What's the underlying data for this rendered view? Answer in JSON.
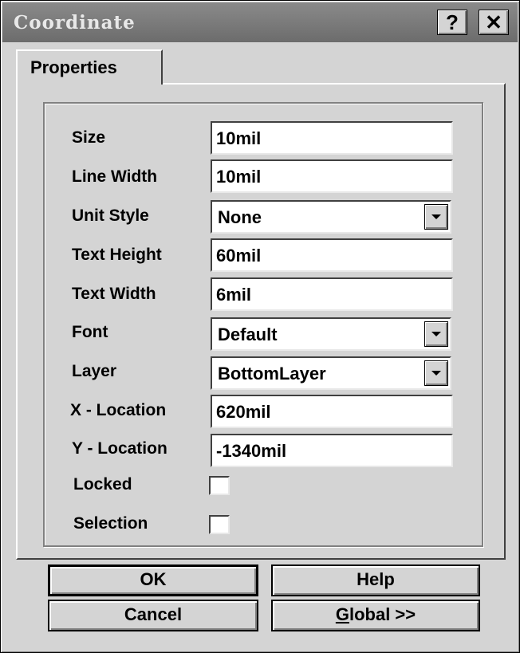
{
  "window": {
    "title": "Coordinate",
    "help_glyph": "?",
    "close_glyph": "✕"
  },
  "tabs": [
    {
      "label": "Properties",
      "active": true
    }
  ],
  "fields": {
    "size": {
      "label": "Size",
      "value": "10mil"
    },
    "line_width": {
      "label": "Line Width",
      "value": "10mil"
    },
    "unit_style": {
      "label": "Unit Style",
      "value": "None"
    },
    "text_height": {
      "label": "Text Height",
      "value": "60mil"
    },
    "text_width": {
      "label": "Text Width",
      "value": "6mil"
    },
    "font": {
      "label": "Font",
      "value": "Default"
    },
    "layer": {
      "label": "Layer",
      "value": "BottomLayer"
    },
    "x_location": {
      "label": "X - Location",
      "value": "620mil"
    },
    "y_location": {
      "label": "Y - Location",
      "value": "-1340mil"
    },
    "locked": {
      "label": "Locked",
      "checked": false
    },
    "selection": {
      "label": "Selection",
      "checked": false
    }
  },
  "buttons": {
    "ok": "OK",
    "help": "Help",
    "cancel": "Cancel",
    "global_mnemonic": "G",
    "global_rest": "lobal >>"
  },
  "icons": {
    "help": "question-mark-icon",
    "close": "close-icon",
    "dropdown": "chevron-down-icon"
  }
}
